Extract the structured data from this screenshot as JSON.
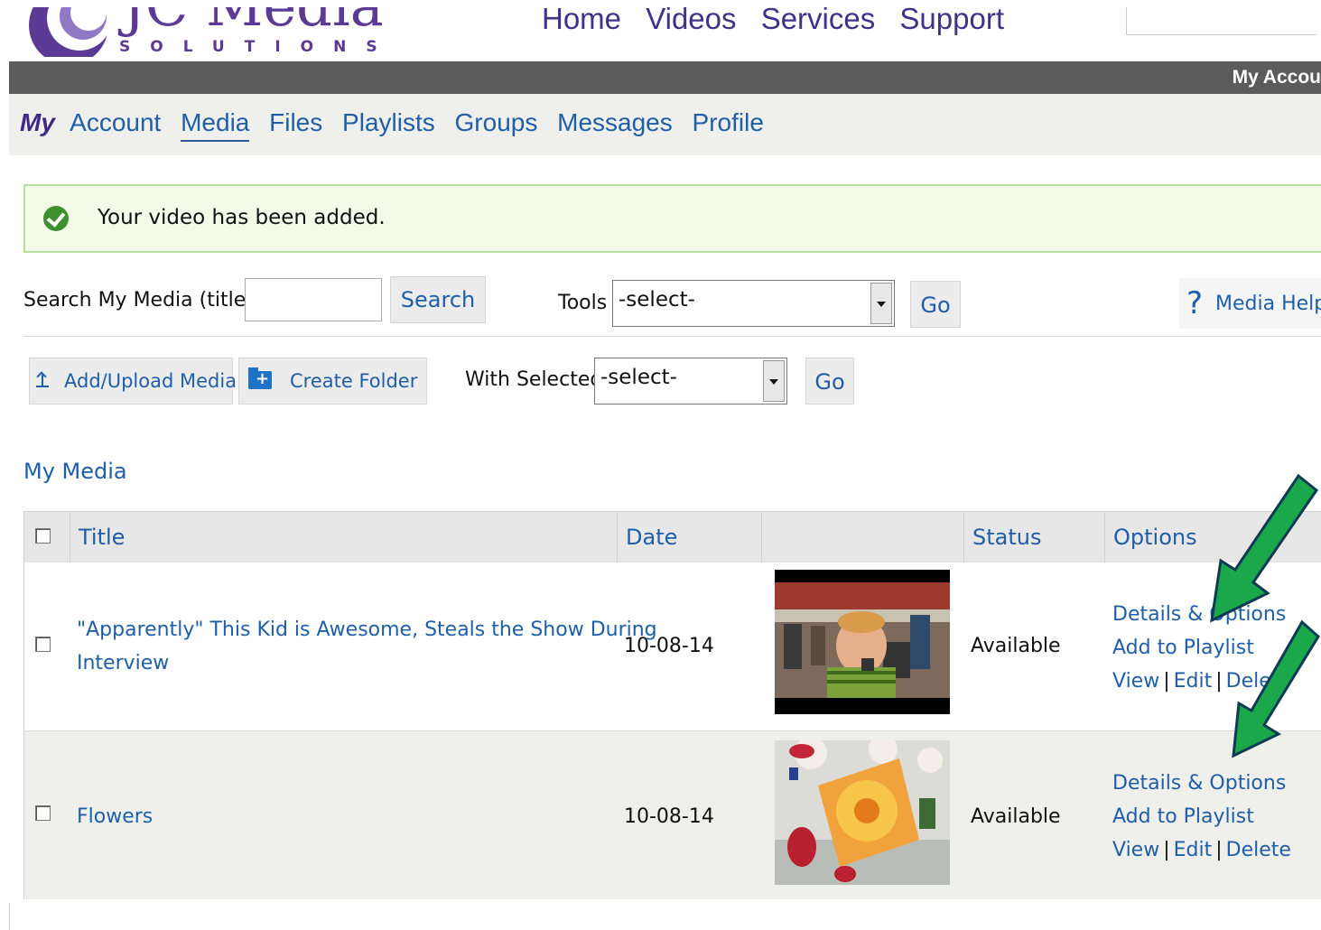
{
  "header": {
    "logo_text": "JC Media",
    "logo_sub": "SOLUTIONS",
    "nav": [
      "Home",
      "Videos",
      "Services",
      "Support"
    ],
    "account_bar_label": "My Accou"
  },
  "subnav": {
    "prefix": "My",
    "items": [
      "Account",
      "Media",
      "Files",
      "Playlists",
      "Groups",
      "Messages",
      "Profile"
    ],
    "active": "Media"
  },
  "alert": {
    "message": "Your video has been added."
  },
  "toolbar": {
    "search_label": "Search My Media (title):",
    "search_value": "",
    "search_button": "Search",
    "tools_label": "Tools",
    "tools_selected": "-select-",
    "go_label": "Go",
    "help_label": "Media Help/",
    "add_upload": "Add/Upload Media",
    "create_folder": "Create Folder",
    "with_selected_label": "With Selected",
    "with_selected_value": "-select-",
    "go2_label": "Go"
  },
  "media": {
    "heading": "My Media",
    "columns": {
      "title": "Title",
      "date": "Date",
      "thumb": "",
      "status": "Status",
      "options": "Options"
    },
    "rows": [
      {
        "title_line1": "\"Apparently\" This Kid is Awesome, Steals the Show During",
        "title_line2": "Interview",
        "date": "10-08-14",
        "status": "Available",
        "details": "Details & Options",
        "add_playlist": "Add to Playlist",
        "view": "View",
        "edit": "Edit",
        "delete": "Dele"
      },
      {
        "title_line1": "Flowers",
        "title_line2": "",
        "date": "10-08-14",
        "status": "Available",
        "details": "Details & Options",
        "add_playlist": "Add to Playlist",
        "view": "View",
        "edit": "Edit",
        "delete": "Delete"
      }
    ]
  },
  "colors": {
    "link": "#1f5ea8",
    "brand": "#5b3a95",
    "arrow": "#1aa84a",
    "alert_bg": "#f1fbe8"
  }
}
